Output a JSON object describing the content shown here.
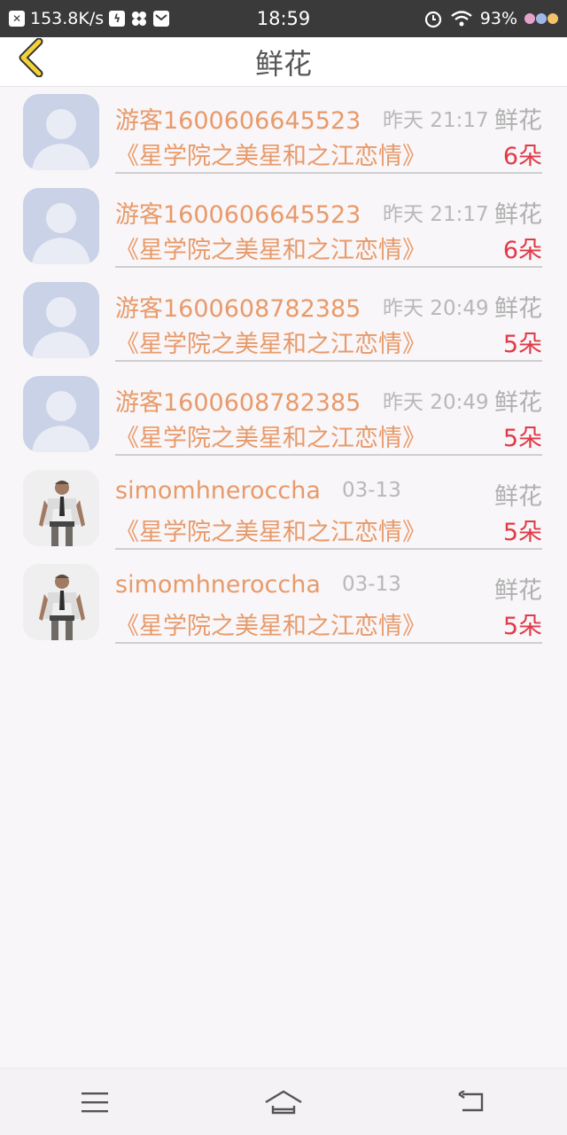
{
  "status_bar": {
    "network_speed": "153.8K/s",
    "time": "18:59",
    "battery": "93%",
    "icons": [
      "notification-x-icon",
      "flash-icon",
      "fan-icon",
      "mail-icon",
      "alarm-icon",
      "wifi-icon",
      "hearts-icon"
    ]
  },
  "header": {
    "title": "鲜花",
    "back_icon": "chevron-left-icon"
  },
  "records": [
    {
      "username": "游客1600606645523",
      "time": "昨天 21:17",
      "gift": "鲜花",
      "book": "《星学院之美星和之江恋情》",
      "count": "6朵",
      "avatar": "default"
    },
    {
      "username": "游客1600606645523",
      "time": "昨天 21:17",
      "gift": "鲜花",
      "book": "《星学院之美星和之江恋情》",
      "count": "6朵",
      "avatar": "default"
    },
    {
      "username": "游客1600608782385",
      "time": "昨天 20:49",
      "gift": "鲜花",
      "book": "《星学院之美星和之江恋情》",
      "count": "5朵",
      "avatar": "default"
    },
    {
      "username": "游客1600608782385",
      "time": "昨天 20:49",
      "gift": "鲜花",
      "book": "《星学院之美星和之江恋情》",
      "count": "5朵",
      "avatar": "default"
    },
    {
      "username": "simomhneroccha",
      "time": "03-13",
      "gift": "鲜花",
      "book": "《星学院之美星和之江恋情》",
      "count": "5朵",
      "avatar": "photo"
    },
    {
      "username": "simomhneroccha",
      "time": "03-13",
      "gift": "鲜花",
      "book": "《星学院之美星和之江恋情》",
      "count": "5朵",
      "avatar": "photo"
    }
  ],
  "bottom_nav": {
    "icons": [
      "menu-icon",
      "home-icon",
      "back-icon"
    ]
  },
  "colors": {
    "accent_orange": "#e89a6a",
    "count_red": "#e03a48",
    "muted_gray": "#b8b8b8"
  }
}
